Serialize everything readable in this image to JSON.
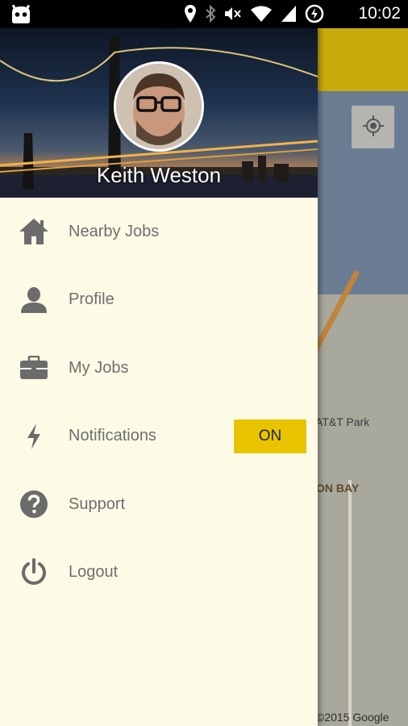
{
  "status_bar": {
    "time": "10:02",
    "icons": [
      "cyanogen-robot-icon",
      "location-pin-icon",
      "bluetooth-icon",
      "mute-icon",
      "wifi-icon",
      "signal-icon",
      "data-saver-icon"
    ]
  },
  "drawer": {
    "user_name": "Keith Weston",
    "items": [
      {
        "label": "Nearby Jobs",
        "icon": "home-icon"
      },
      {
        "label": "Profile",
        "icon": "person-icon"
      },
      {
        "label": "My Jobs",
        "icon": "briefcase-icon"
      },
      {
        "label": "Notifications",
        "icon": "bolt-icon",
        "toggle": "ON"
      },
      {
        "label": "Support",
        "icon": "help-circle-icon"
      },
      {
        "label": "Logout",
        "icon": "power-icon"
      }
    ]
  },
  "map": {
    "labels": {
      "park": "AT&T Park",
      "bay": "ON BAY"
    },
    "copyright": "©2015 Google"
  },
  "colors": {
    "accent": "#e8c400",
    "drawer_bg": "#fdfbe6",
    "menu_text": "#6f6f6f",
    "icon": "#6b6b6b"
  }
}
